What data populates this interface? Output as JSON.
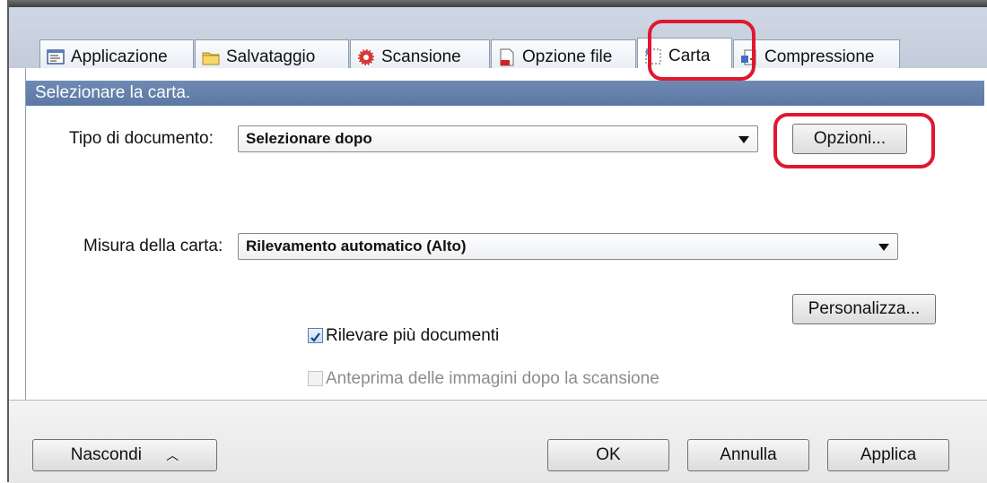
{
  "tabs": [
    {
      "label": "Applicazione",
      "icon": "application-icon"
    },
    {
      "label": "Salvataggio",
      "icon": "folder-icon"
    },
    {
      "label": "Scansione",
      "icon": "scan-icon"
    },
    {
      "label": "Opzione file",
      "icon": "file-option-icon"
    },
    {
      "label": "Carta",
      "icon": "paper-icon",
      "active": true
    },
    {
      "label": "Compressione",
      "icon": "compression-icon"
    }
  ],
  "section": {
    "title": "Selezionare la carta."
  },
  "document_type": {
    "label": "Tipo di documento:",
    "value": "Selezionare dopo",
    "button": "Opzioni..."
  },
  "paper_size": {
    "label": "Misura della carta:",
    "value": "Rilevamento automatico (Alto)",
    "button": "Personalizza..."
  },
  "checkboxes": {
    "detect_multiple": {
      "label": "Rilevare più documenti",
      "checked": true
    },
    "preview": {
      "label": "Anteprima delle immagini dopo la scansione",
      "checked": false,
      "disabled": true
    }
  },
  "footer": {
    "hide": "Nascondi",
    "ok": "OK",
    "cancel": "Annulla",
    "apply": "Applica"
  },
  "colors": {
    "section_header": "#5b78a4",
    "highlight": "#e0182e",
    "tabstrip": "#c9d1de"
  }
}
